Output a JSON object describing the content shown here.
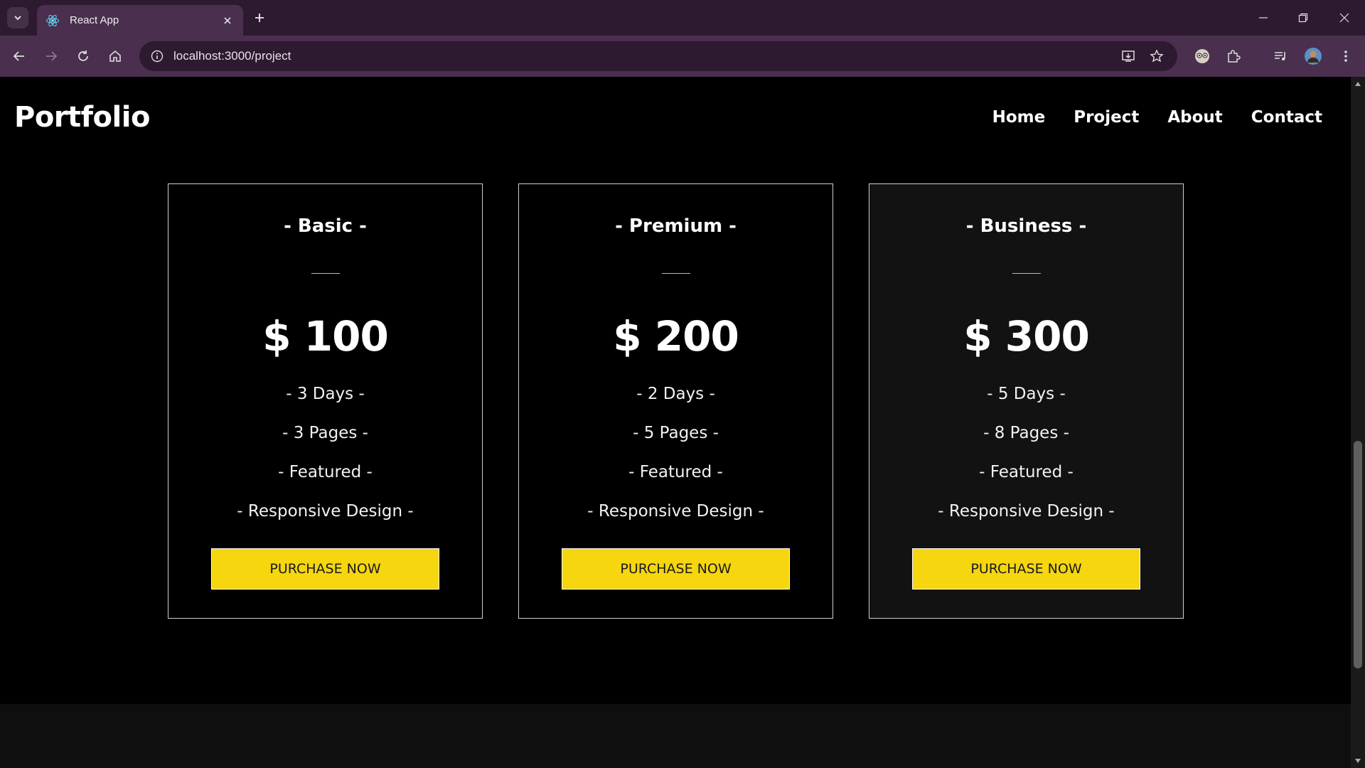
{
  "browser": {
    "tab_title": "React App",
    "url": "localhost:3000/project"
  },
  "site": {
    "logo": "Portfolio",
    "nav": [
      "Home",
      "Project",
      "About",
      "Contact"
    ]
  },
  "plans": [
    {
      "name": "- Basic -",
      "price": "$ 100",
      "features": [
        "- 3 Days -",
        "- 3 Pages -",
        "- Featured -",
        "- Responsive Design -"
      ],
      "button": "PURCHASE NOW"
    },
    {
      "name": "- Premium -",
      "price": "$ 200",
      "features": [
        "- 2 Days -",
        "- 5 Pages -",
        "- Featured -",
        "- Responsive Design -"
      ],
      "button": "PURCHASE NOW"
    },
    {
      "name": "- Business -",
      "price": "$ 300",
      "features": [
        "- 5 Days -",
        "- 8 Pages -",
        "- Featured -",
        "- Responsive Design -"
      ],
      "button": "PURCHASE NOW"
    }
  ],
  "colors": {
    "accent": "#f5d60f",
    "chrome_dark": "#2e1a30",
    "chrome_light": "#4a2f4f",
    "page_bg": "#000000"
  },
  "icons": [
    "react-favicon-icon",
    "tab-list-icon",
    "close-icon",
    "plus-icon",
    "minimize-icon",
    "restore-icon",
    "back-icon",
    "forward-icon",
    "reload-icon",
    "home-icon",
    "site-info-icon",
    "install-icon",
    "star-icon",
    "extension-icon",
    "puzzle-icon",
    "media-icon",
    "profile-icon",
    "menu-icon"
  ]
}
